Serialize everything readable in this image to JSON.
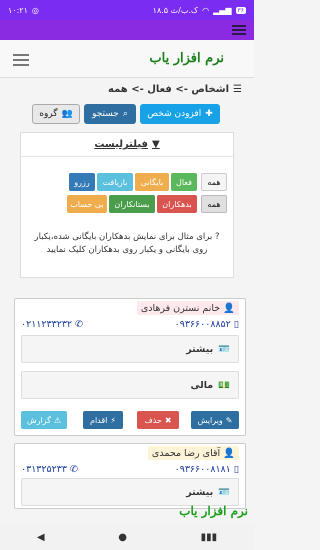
{
  "status_bar": {
    "time": "۱۰:۲۱",
    "battery": "۳۶",
    "speed": "۱۸.۵ ک.ب/ث"
  },
  "app": {
    "title": "نرم افزار یاب"
  },
  "breadcrumb": {
    "text": "اشخاص -> فعال -> همه"
  },
  "actions": {
    "add_person": "افزودن شخص",
    "search": "جستجو",
    "group": "گروه"
  },
  "filter": {
    "title": "فیلترلیست",
    "chips_row1": [
      {
        "label": "همه",
        "color": "#f4f4f4"
      },
      {
        "label": "فعال",
        "color": "#5cb85c"
      },
      {
        "label": "بایگانی",
        "color": "#f0ad4e"
      },
      {
        "label": "بازیافت",
        "color": "#5bc0de"
      },
      {
        "label": "رزرو",
        "color": "#337ab7"
      }
    ],
    "chips_row2": [
      {
        "label": "همه",
        "color": "#e0e0e0"
      },
      {
        "label": "بدهکاران",
        "color": "#d9534f"
      },
      {
        "label": "بستانکاران",
        "color": "#4a9d4a"
      },
      {
        "label": "بی حساب",
        "color": "#f0ad4e"
      }
    ],
    "hint": "برای مثال برای نمایش بدهکاران بایگانی شده،یکبار روی بایگانی و یکبار روی بدهکاران کلیک نمایید"
  },
  "people": [
    {
      "name": "خانم نسترن فرهادی",
      "mobile": "۰۹۳۶۶۰۰۸۸۵۲",
      "phone": "۰۲۱۱۲۳۳۲۳۲",
      "more_label": "بیشتر",
      "finance_label": "مالی",
      "buttons": {
        "edit": "ویرایش",
        "delete": "حذف",
        "act": "اقدام",
        "report": "گزارش"
      }
    },
    {
      "name": "آقای رضا محمدی",
      "mobile": "۰۹۳۶۶۰۰۸۱۸۱",
      "phone": "۰۳۱۳۲۵۲۳۳",
      "more_label": "بیشتر"
    }
  ],
  "watermark": "نرم افزار یاب",
  "colors": {
    "status_bar": "#7a2df0",
    "accent_purple": "#8a2be2",
    "brand_green": "#1a7f1a",
    "btn_add": "#17a2e8",
    "btn_search": "#2f6ea0"
  }
}
